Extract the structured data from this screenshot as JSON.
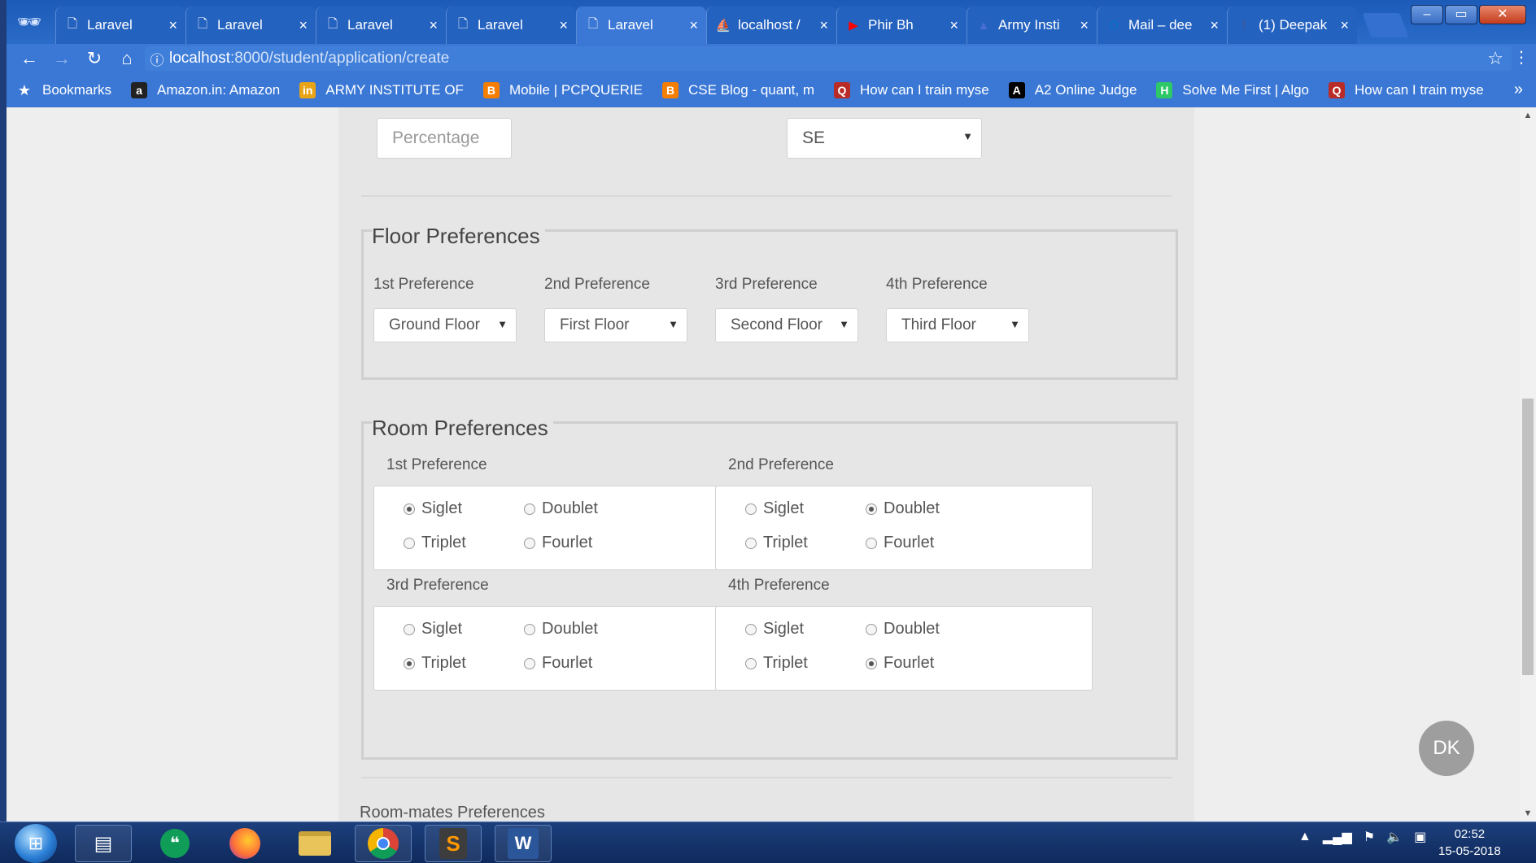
{
  "browser": {
    "tabs": [
      {
        "title": "Laravel",
        "icon": "page-icon"
      },
      {
        "title": "Laravel",
        "icon": "page-icon"
      },
      {
        "title": "Laravel",
        "icon": "page-icon"
      },
      {
        "title": "Laravel",
        "icon": "page-icon"
      },
      {
        "title": "Laravel",
        "icon": "page-icon",
        "active": true
      },
      {
        "title": "localhost / ",
        "icon": "phpmyadmin-icon"
      },
      {
        "title": "Phir Bh",
        "icon": "youtube-icon"
      },
      {
        "title": "Army Insti",
        "icon": "army-icon"
      },
      {
        "title": "Mail – dee",
        "icon": "outlook-icon"
      },
      {
        "title": "(1) Deepak",
        "icon": "facebook-icon"
      }
    ],
    "url_host": "localhost",
    "url_path": ":8000/student/application/create",
    "bookmarks_label": "Bookmarks",
    "bookmarks": [
      {
        "label": "Amazon.in: Amazon",
        "icon": "a",
        "color": "#222222"
      },
      {
        "label": "ARMY INSTITUTE OF",
        "icon": "in",
        "color": "#e8a317"
      },
      {
        "label": "Mobile | PCPQUERIE",
        "icon": "B",
        "color": "#f57d00"
      },
      {
        "label": "CSE Blog - quant, m",
        "icon": "B",
        "color": "#f57d00"
      },
      {
        "label": "How can I train myse",
        "icon": "Q",
        "color": "#b92b27"
      },
      {
        "label": "A2 Online Judge",
        "icon": "A",
        "color": "#000000"
      },
      {
        "label": "Solve Me First | Algo",
        "icon": "H",
        "color": "#2ec866"
      },
      {
        "label": "How can I train myse",
        "icon": "Q",
        "color": "#b92b27"
      }
    ]
  },
  "form": {
    "percentage_placeholder": "Percentage",
    "branch_value": "SE",
    "floor": {
      "legend": "Floor Preferences",
      "prefs": [
        {
          "label": "1st Preference",
          "value": "Ground Floor"
        },
        {
          "label": "2nd Preference",
          "value": "First Floor"
        },
        {
          "label": "3rd Preference",
          "value": "Second Floor"
        },
        {
          "label": "4th Preference",
          "value": "Third Floor"
        }
      ]
    },
    "room": {
      "legend": "Room Preferences",
      "options": [
        "Siglet",
        "Doublet",
        "Triplet",
        "Fourlet"
      ],
      "prefs": [
        {
          "label": "1st Preference",
          "selected": "Siglet"
        },
        {
          "label": "2nd Preference",
          "selected": "Doublet"
        },
        {
          "label": "3rd Preference",
          "selected": "Triplet"
        },
        {
          "label": "4th Preference",
          "selected": "Fourlet"
        }
      ]
    },
    "next_section": "Room-mates Preferences"
  },
  "avatar_initials": "DK",
  "taskbar": {
    "time": "02:52",
    "date": "15-05-2018"
  }
}
